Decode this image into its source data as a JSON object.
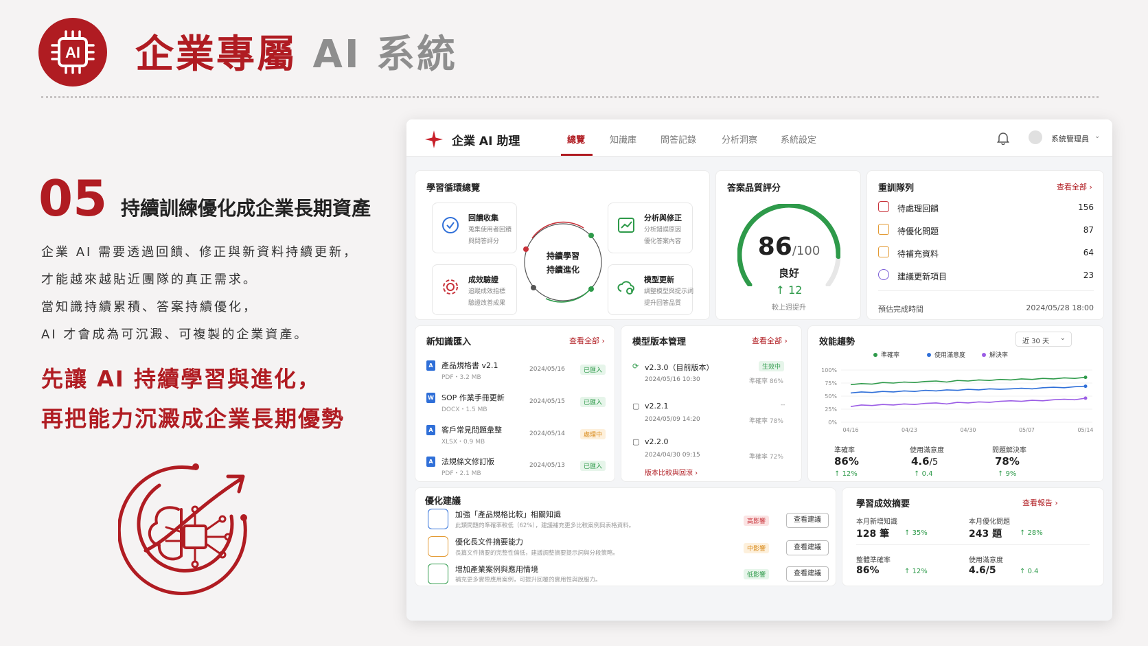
{
  "slide": {
    "title_main": "企業專屬",
    "title_ai": " AI 系統",
    "step_number": "05",
    "step_heading": "持續訓練優化成企業長期資產",
    "paragraph": [
      "企業 AI 需要透過回饋、修正與新資料持續更新，",
      "才能越來越貼近團隊的真正需求。",
      "當知識持續累積、答案持續優化，",
      "AI 才會成為可沉澱、可複製的企業資產。"
    ],
    "highlight": [
      "先讓 AI 持續學習與進化，",
      "再把能力沉澱成企業長期優勢"
    ],
    "logo_text": "AI"
  },
  "app": {
    "brand": "企業 AI 助理",
    "nav": [
      "總覽",
      "知識庫",
      "問答記錄",
      "分析洞察",
      "系統設定"
    ],
    "user": "系統管理員",
    "loop": {
      "title": "學習循環總覽",
      "center": [
        "持續學習",
        "持續進化"
      ],
      "boxes": [
        {
          "title": "回饋收集",
          "desc": [
            "蒐集使用者回饋",
            "與問答評分"
          ]
        },
        {
          "title": "分析與修正",
          "desc": [
            "分析錯誤原因",
            "優化答案內容"
          ]
        },
        {
          "title": "成效驗證",
          "desc": [
            "追蹤成效指標",
            "驗證改善成果"
          ]
        },
        {
          "title": "模型更新",
          "desc": [
            "調整模型與提示詞",
            "提升回答品質"
          ]
        }
      ]
    },
    "quality": {
      "title": "答案品質評分",
      "score": "86",
      "max": "/100",
      "score_value": 86,
      "rating": "良好",
      "delta": "12",
      "delta_label": "較上週提升"
    },
    "queue": {
      "title": "重訓隊列",
      "link": "查看全部",
      "items": [
        {
          "label": "待處理回饋",
          "value": "156"
        },
        {
          "label": "待優化問題",
          "value": "87"
        },
        {
          "label": "待補充資料",
          "value": "64"
        },
        {
          "label": "建議更新項目",
          "value": "23"
        }
      ],
      "eta_label": "預估完成時間",
      "eta_value": "2024/05/28 18:00"
    },
    "knowledge": {
      "title": "新知識匯入",
      "link": "查看全部",
      "items": [
        {
          "name": "產品規格書 v2.1",
          "meta": "PDF・3.2 MB",
          "date": "2024/05/16",
          "status": "已匯入",
          "type": "pdf"
        },
        {
          "name": "SOP 作業手冊更新",
          "meta": "DOCX・1.5 MB",
          "date": "2024/05/15",
          "status": "已匯入",
          "type": "word"
        },
        {
          "name": "客戶常見問題彙整",
          "meta": "XLSX・0.9 MB",
          "date": "2024/05/14",
          "status": "處理中",
          "type": "pdf"
        },
        {
          "name": "法規條文修訂版",
          "meta": "PDF・2.1 MB",
          "date": "2024/05/13",
          "status": "已匯入",
          "type": "pdf"
        }
      ]
    },
    "versions": {
      "title": "模型版本管理",
      "link": "查看全部",
      "items": [
        {
          "version": "v2.3.0（目前版本）",
          "time": "2024/05/16 10:30",
          "status": "生效中",
          "acc": "準確率 86%"
        },
        {
          "version": "v2.2.1",
          "time": "2024/05/09 14:20",
          "status": "--",
          "acc": "準確率 78%"
        },
        {
          "version": "v2.2.0",
          "time": "2024/04/30 09:15",
          "status": "",
          "acc": "準確率 72%"
        }
      ],
      "compare_link": "版本比較與回滾"
    },
    "trend": {
      "title": "效能趨勢",
      "range": "近 30 天",
      "kpis": [
        {
          "label": "準確率",
          "value": "86%",
          "delta": "12%"
        },
        {
          "label": "使用滿意度",
          "value": "4.6",
          "unit": "/5",
          "delta": "0.4"
        },
        {
          "label": "問題解決率",
          "value": "78%",
          "delta": "9%"
        }
      ]
    },
    "suggestions": {
      "title": "優化建議",
      "button": "查看建議",
      "items": [
        {
          "title": "加強「產品規格比較」相關知識",
          "desc": "此類問題的準確率較低（62%），建議補充更多比較案例與表格資料。",
          "impact": "高影響"
        },
        {
          "title": "優化長文件摘要能力",
          "desc": "長篇文件摘要的完整性偏低，建議調整摘要提示詞與分段策略。",
          "impact": "中影響"
        },
        {
          "title": "增加產業案例與應用情境",
          "desc": "補充更多實際應用案例，可提升回覆的實用性與說服力。",
          "impact": "低影響"
        }
      ]
    },
    "summary": {
      "title": "學習成效摘要",
      "link": "查看報告",
      "items": [
        {
          "label": "本月新增知識",
          "value": "128 筆",
          "delta": "35%"
        },
        {
          "label": "本月優化問題",
          "value": "243 題",
          "delta": "28%"
        },
        {
          "label": "整體準確率",
          "value": "86%",
          "delta": "12%"
        },
        {
          "label": "使用滿意度",
          "value": "4.6/5",
          "delta": "0.4"
        }
      ]
    }
  },
  "chart_data": {
    "type": "line",
    "title": "效能趨勢",
    "x": [
      "04/16",
      "04/23",
      "04/30",
      "05/07",
      "05/14"
    ],
    "yticks": [
      "100%",
      "75%",
      "50%",
      "25%",
      "0%"
    ],
    "ylim": [
      0,
      100
    ],
    "legend": "top",
    "grid": true,
    "series": [
      {
        "name": "準確率",
        "color": "#2e9a4a",
        "values": [
          72,
          74,
          73,
          76,
          75,
          77,
          76,
          78,
          79,
          77,
          80,
          79,
          81,
          80,
          82,
          81,
          83,
          82,
          84,
          83,
          85,
          84,
          86
        ]
      },
      {
        "name": "使用滿意度",
        "color": "#2f6fd8",
        "values": [
          56,
          58,
          57,
          59,
          58,
          60,
          59,
          61,
          60,
          62,
          61,
          63,
          62,
          64,
          63,
          64,
          65,
          64,
          66,
          67,
          66,
          68,
          69
        ]
      },
      {
        "name": "解決率",
        "color": "#9b5de5",
        "values": [
          30,
          33,
          32,
          34,
          33,
          35,
          34,
          36,
          37,
          35,
          38,
          37,
          39,
          38,
          40,
          41,
          40,
          42,
          41,
          43,
          44,
          43,
          46
        ]
      }
    ]
  }
}
